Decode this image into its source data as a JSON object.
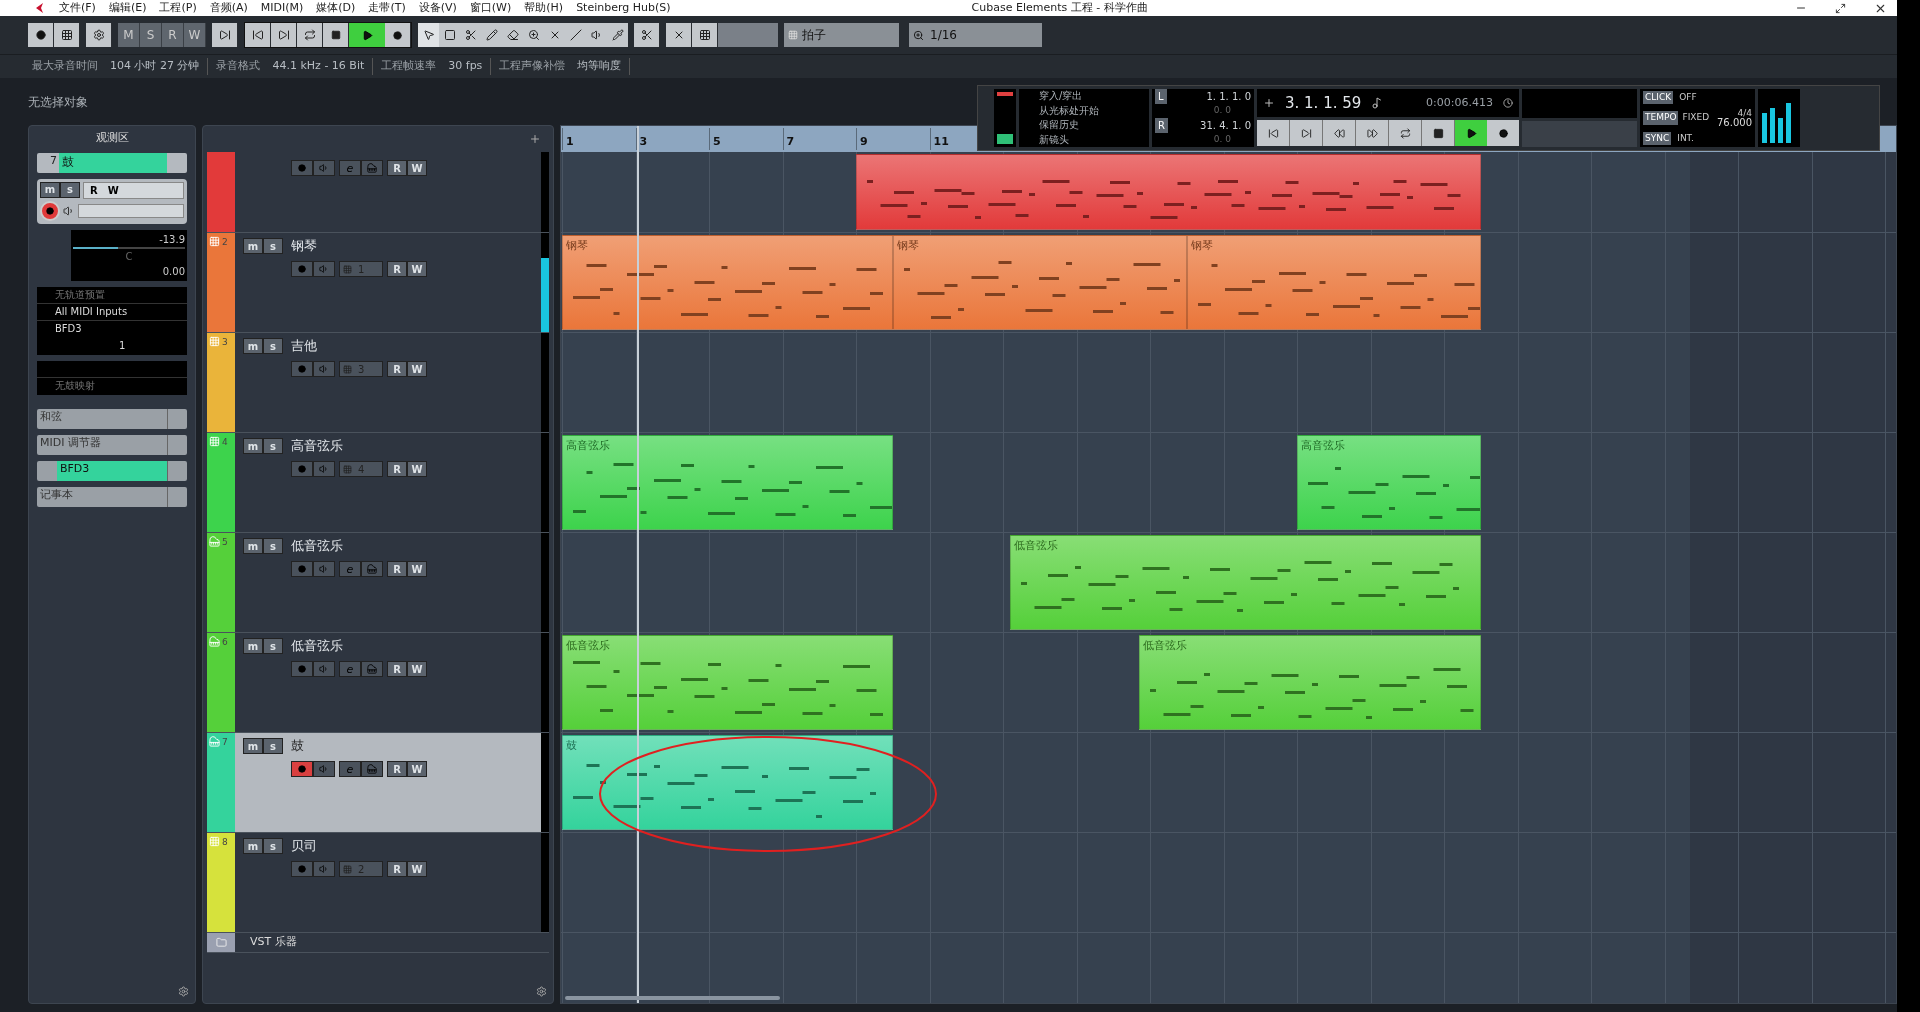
{
  "window": {
    "title": "Cubase Elements 工程 - 科学作曲"
  },
  "menu": [
    "文件(F)",
    "编辑(E)",
    "工程(P)",
    "音频(A)",
    "MIDI(M)",
    "媒体(D)",
    "走带(T)",
    "设备(V)",
    "窗口(W)",
    "帮助(H)",
    "Steinberg Hub(S)"
  ],
  "toolbar": {
    "mode_buttons": [
      "M",
      "S",
      "R",
      "W"
    ],
    "play_active": true,
    "snap_type": "拍子",
    "quantize": "1/16"
  },
  "info_bar": [
    {
      "label": "最大录音时间",
      "value": "104 小时 27 分钟"
    },
    {
      "label": "录音格式",
      "value": "44.1 kHz - 16 Bit"
    },
    {
      "label": "工程帧速率",
      "value": "30 fps"
    },
    {
      "label": "工程声像补偿",
      "value": "均等响度"
    }
  ],
  "status": "无选择对象",
  "inspector": {
    "title": "观测区",
    "track_number": "7",
    "track_name": "鼓",
    "mute": "m",
    "solo": "s",
    "read": "R",
    "write": "W",
    "record": true,
    "volume": "-13.9",
    "level": 0.4,
    "pan": "C",
    "delay": "0.00",
    "preset": "无轨道预置",
    "input": "All MIDI Inputs",
    "output": "BFD3",
    "channel": "1",
    "drum_map": "无鼓映射",
    "sections": [
      {
        "kind": "plain",
        "label": "和弦"
      },
      {
        "kind": "plain",
        "label": "MIDI 调节器"
      },
      {
        "kind": "instrument",
        "label": "BFD3"
      },
      {
        "kind": "plain",
        "label": "记事本"
      }
    ]
  },
  "tracks": [
    {
      "kind": "instrument",
      "color": "#e23a3a",
      "selected": false,
      "record": false,
      "edit": "e",
      "read": "R",
      "write": "W",
      "parts": [
        {
          "selected": false
        }
      ]
    },
    {
      "kind": "midi",
      "number": "2",
      "name": "钢琴",
      "color": "#ea763a",
      "selected": false,
      "record": false,
      "mute": "m",
      "solo": "s",
      "channel": "1",
      "read": "R",
      "write": "W",
      "level": 0.75,
      "parts": [
        {
          "label": "钢琴",
          "selected": false
        },
        {
          "label": "钢琴",
          "selected": false
        },
        {
          "label": "钢琴",
          "selected": false
        }
      ]
    },
    {
      "kind": "midi",
      "number": "3",
      "name": "吉他",
      "color": "#eab43a",
      "selected": false,
      "record": false,
      "mute": "m",
      "solo": "s",
      "channel": "3",
      "read": "R",
      "write": "W"
    },
    {
      "kind": "midi",
      "number": "4",
      "name": "高音弦乐",
      "color": "#3dd34c",
      "selected": false,
      "record": false,
      "mute": "m",
      "solo": "s",
      "channel": "4",
      "read": "R",
      "write": "W",
      "parts": [
        {
          "label": "高音弦乐",
          "selected": false
        },
        {
          "label": "高音弦乐",
          "selected": false
        }
      ]
    },
    {
      "kind": "instrument",
      "number": "5",
      "name": "低音弦乐",
      "color": "#55d03a",
      "selected": false,
      "record": false,
      "mute": "m",
      "solo": "s",
      "edit": "e",
      "read": "R",
      "write": "W",
      "parts": [
        {
          "label": "低音弦乐",
          "selected": false
        }
      ]
    },
    {
      "kind": "instrument",
      "number": "6",
      "name": "低音弦乐",
      "color": "#55d03a",
      "selected": false,
      "record": false,
      "mute": "m",
      "solo": "s",
      "edit": "e",
      "read": "R",
      "write": "W",
      "parts": [
        {
          "label": "低音弦乐",
          "selected": false
        },
        {
          "label": "低音弦乐",
          "selected": false
        }
      ]
    },
    {
      "kind": "instrument",
      "number": "7",
      "name": "鼓",
      "color": "#34d39c",
      "selected": true,
      "record": true,
      "mute": "m",
      "solo": "s",
      "edit": "e",
      "read": "R",
      "write": "W",
      "parts": [
        {
          "label": "鼓",
          "selected": false
        }
      ]
    },
    {
      "kind": "midi",
      "number": "8",
      "name": "贝司",
      "color": "#d6e23c",
      "selected": false,
      "record": false,
      "mute": "m",
      "solo": "s",
      "channel": "2",
      "read": "R",
      "write": "W"
    }
  ],
  "folder": {
    "name": "VST 乐器"
  },
  "ruler": [
    "1",
    "3",
    "5",
    "7",
    "9",
    "11"
  ],
  "transport": {
    "punch": [
      "穿入/穿出",
      "从光标处开始",
      "保留历史",
      "新镜头"
    ],
    "left_label": "L",
    "left": "1. 1. 1. 0",
    "left_sub": "0. 0",
    "right_label": "R",
    "right": "31. 4. 1. 0",
    "right_sub": "0. 0",
    "position": "3. 1. 1. 59",
    "time": "0:00:06.413",
    "play_active": true,
    "click_label": "CLICK",
    "click": "OFF",
    "tempo_label": "TEMPO",
    "tempo_mode": "FIXED",
    "signature": "4/4",
    "tempo": "76.000",
    "sync_label": "SYNC",
    "sync": "INT."
  }
}
